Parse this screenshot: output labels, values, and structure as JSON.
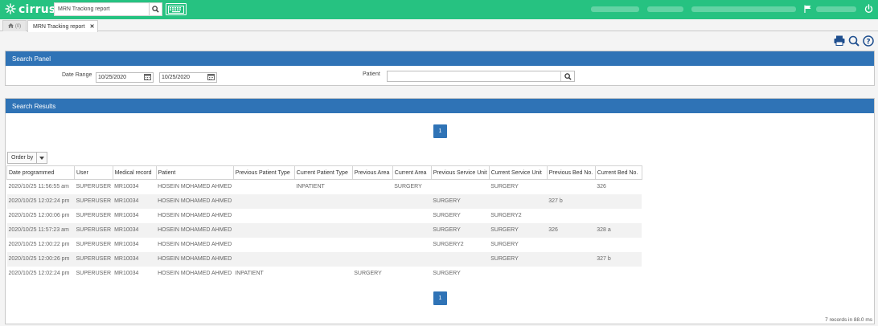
{
  "app": {
    "logo_text": "cirrus",
    "search_value": "MRN Tracking report"
  },
  "tabs": [
    {
      "label": "(0)"
    },
    {
      "label": "MRN Tracking report"
    }
  ],
  "search_panel": {
    "title": "Search Panel",
    "date_range_label": "Date Range",
    "date_from": "10/25/2020",
    "date_to": "10/25/2020",
    "patient_label": "Patient",
    "patient_value": ""
  },
  "results_panel": {
    "title": "Search Results",
    "page_top": "1",
    "page_bottom": "1",
    "order_by_label": "Order by",
    "records_text": "7 records in 88.0 ms",
    "columns": [
      "Date programmed",
      "User",
      "Medical record",
      "Patient",
      "Previous Patient Type",
      "Current Patient Type",
      "Previous Area",
      "Current Area",
      "Previous Service Unit",
      "Current Service Unit",
      "Previous Bed No.",
      "Current Bed No."
    ],
    "rows": [
      [
        "2020/10/25 11:56:55 am",
        "SUPERUSER",
        "MR10034",
        "HOSEIN MOHAMED AHMED",
        "",
        "INPATIENT",
        "",
        "SURGERY",
        "",
        "SURGERY",
        "",
        "326"
      ],
      [
        "2020/10/25 12:02:24 pm",
        "SUPERUSER",
        "MR10034",
        "HOSEIN MOHAMED AHMED",
        "",
        "",
        "",
        "",
        "SURGERY",
        "",
        "327 b",
        ""
      ],
      [
        "2020/10/25 12:00:06 pm",
        "SUPERUSER",
        "MR10034",
        "HOSEIN MOHAMED AHMED",
        "",
        "",
        "",
        "",
        "SURGERY",
        "SURGERY2",
        "",
        ""
      ],
      [
        "2020/10/25 11:57:23 am",
        "SUPERUSER",
        "MR10034",
        "HOSEIN MOHAMED AHMED",
        "",
        "",
        "",
        "",
        "SURGERY",
        "SURGERY",
        "326",
        "328 a"
      ],
      [
        "2020/10/25 12:00:22 pm",
        "SUPERUSER",
        "MR10034",
        "HOSEIN MOHAMED AHMED",
        "",
        "",
        "",
        "",
        "SURGERY2",
        "SURGERY",
        "",
        ""
      ],
      [
        "2020/10/25 12:00:26 pm",
        "SUPERUSER",
        "MR10034",
        "HOSEIN MOHAMED AHMED",
        "",
        "",
        "",
        "",
        "",
        "SURGERY",
        "",
        "327 b"
      ],
      [
        "2020/10/25 12:02:24 pm",
        "SUPERUSER",
        "MR10034",
        "HOSEIN MOHAMED AHMED",
        "INPATIENT",
        "",
        "SURGERY",
        "",
        "SURGERY",
        "",
        "",
        ""
      ]
    ]
  },
  "colors": {
    "topbar": "#26c281",
    "panel_header": "#2f73b6",
    "row_alt": "#f2f2f2"
  },
  "icons": [
    "asterisk-logo-icon",
    "search-icon",
    "keyboard-icon",
    "flag-icon",
    "power-icon",
    "home-icon",
    "close-icon",
    "print-icon",
    "zoom-icon",
    "help-icon",
    "calendar-icon",
    "caret-down-icon"
  ]
}
